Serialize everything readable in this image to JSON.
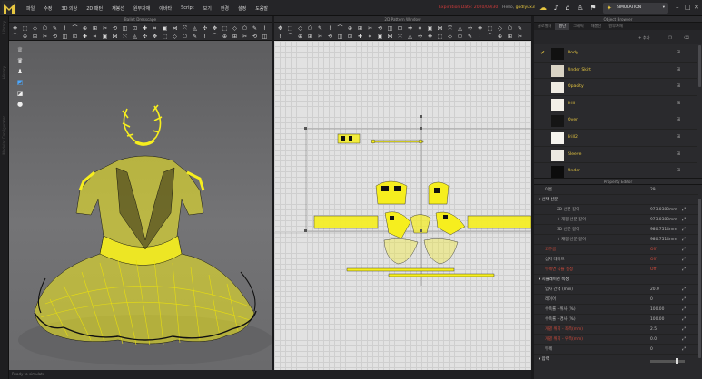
{
  "app": {
    "logo_text": "M"
  },
  "menu": [
    "파일",
    "수정",
    "3D 의상",
    "2D 패턴",
    "재봉선",
    "원부자재",
    "아바타",
    "Script",
    "보기",
    "환경",
    "설정",
    "도움말"
  ],
  "expiration": {
    "label": "Expiration Date:",
    "date": "2020/09/30"
  },
  "user": {
    "label": "Hello,",
    "name": "godlyux3"
  },
  "simulation": {
    "label": "SIMULATION"
  },
  "panels": {
    "left_title": "Ballet Dresscape",
    "center_title": "2D Pattern Window",
    "object_browser": "Object Browser",
    "property_editor": "Property Editor"
  },
  "object_browser": {
    "tabs": [
      "글로벌더",
      "원단",
      "그래픽",
      "재봉선",
      "원부자재"
    ],
    "active_tab": "원단",
    "add_label": "+ 추가",
    "fabrics": [
      {
        "name": "Body",
        "color": "#111111",
        "checked": true
      },
      {
        "name": "Under Skirt",
        "color": "#d9d3c4",
        "checked": false
      },
      {
        "name": "Opacity",
        "color": "#efebe2",
        "checked": false
      },
      {
        "name": "Frill",
        "color": "#f3f0e8",
        "checked": false
      },
      {
        "name": "Over",
        "color": "#151515",
        "checked": false
      },
      {
        "name": "Frill2",
        "color": "#f5f3ee",
        "checked": false
      },
      {
        "name": "Sleeve",
        "color": "#ece9e2",
        "checked": false
      },
      {
        "name": "Under",
        "color": "#0c0c0c",
        "checked": false
      }
    ]
  },
  "property_editor": {
    "name_label": "이름",
    "name_value": "29",
    "rows": [
      {
        "label": "선택 선분",
        "type": "section"
      },
      {
        "label": "2D 선분 길이",
        "value": "973.0383mm",
        "type": "indent"
      },
      {
        "label": "↳ 재봉 선분 길이",
        "value": "973.0383mm",
        "type": "indent"
      },
      {
        "label": "3D 선분 길이",
        "value": "980.7514mm",
        "type": "indent"
      },
      {
        "label": "↳ 재봉 선분 길이",
        "value": "980.7514mm",
        "type": "indent"
      },
      {
        "label": "고주름",
        "value": "Off",
        "type": "red"
      },
      {
        "label": "심지 테이프",
        "value": "Off",
        "type": "normal"
      },
      {
        "label": "두께면 곡률 설정",
        "value": "Off",
        "type": "red"
      },
      {
        "label": "시뮬레이션 속성",
        "type": "section"
      },
      {
        "label": "입자 간격 (mm)",
        "value": "20.0",
        "type": "normal"
      },
      {
        "label": "레이어",
        "value": "0",
        "type": "normal"
      },
      {
        "label": "수축률 - 위사 (%)",
        "value": "100.00",
        "type": "normal"
      },
      {
        "label": "수축률 - 경사 (%)",
        "value": "100.00",
        "type": "normal"
      },
      {
        "label": "개별 위치 - 좌측(mm)",
        "value": "2.5",
        "type": "red"
      },
      {
        "label": "개별 위치 - 우측(mm)",
        "value": "0.0",
        "type": "red"
      },
      {
        "label": "두께",
        "value": "0",
        "type": "normal"
      },
      {
        "label": "압력",
        "type": "section"
      }
    ]
  },
  "status": {
    "text": "Ready to simulate"
  },
  "colors": {
    "accent": "#e6c640",
    "warning": "#d23b3b",
    "garment": "#f6ee1e"
  }
}
